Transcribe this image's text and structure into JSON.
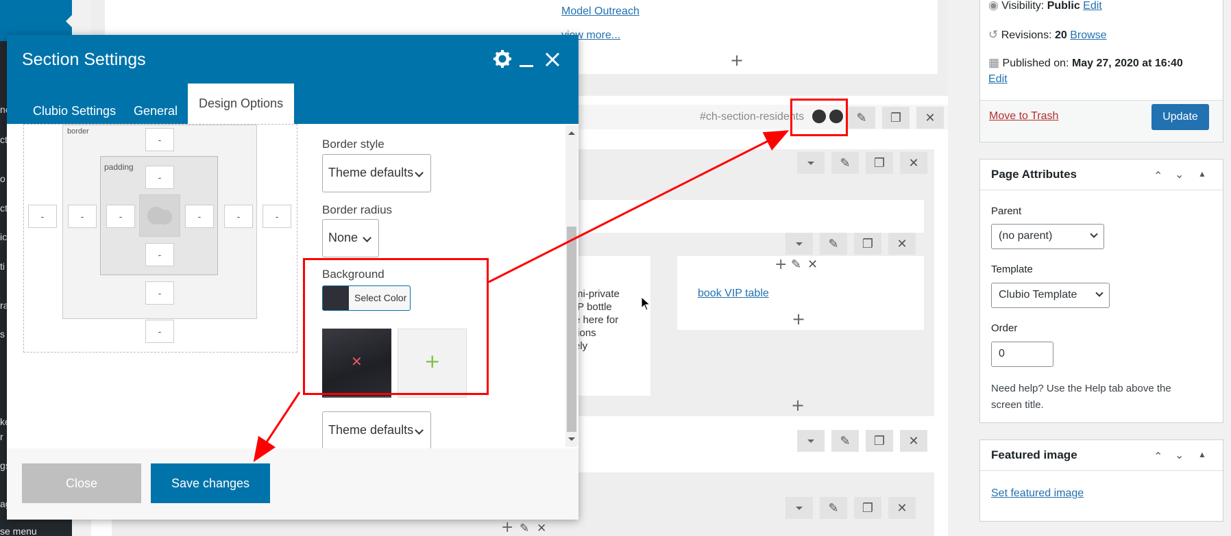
{
  "admin_menu": {
    "fragments": [
      "ne",
      "ct",
      "o",
      "ct",
      "ic",
      "ti",
      "ra",
      "s",
      "ke",
      "r",
      "gs",
      "ag"
    ],
    "collapse_label": "se menu"
  },
  "canvas": {
    "link_model_outreach": "Model Outreach",
    "link_view_more": "view more...",
    "section_id": "#ch-section-residents",
    "text_snippet": [
      "mi-private",
      "IP bottle",
      "e here for",
      "tions",
      "ely"
    ],
    "link_book_vip": "book VIP table"
  },
  "publish": {
    "visibility_label": "Visibility:",
    "visibility_value": "Public",
    "visibility_edit": "Edit",
    "revisions_label": "Revisions:",
    "revisions_value": "20",
    "revisions_browse": "Browse",
    "published_label": "Published on:",
    "published_value": "May 27, 2020 at 16:40",
    "published_edit": "Edit",
    "trash_label": "Move to Trash",
    "update_label": "Update"
  },
  "page_attributes": {
    "title": "Page Attributes",
    "parent_label": "Parent",
    "parent_value": "(no parent)",
    "template_label": "Template",
    "template_value": "Clubio Template",
    "order_label": "Order",
    "order_value": "0",
    "help_text": "Need help? Use the Help tab above the screen title."
  },
  "featured_image": {
    "title": "Featured image",
    "set_link": "Set featured image"
  },
  "modal": {
    "title": "Section Settings",
    "tabs": [
      "Clubio Settings",
      "General",
      "Design Options"
    ],
    "box_labels": {
      "border": "border",
      "padding": "padding"
    },
    "box_placeholder": "-",
    "border_style_label": "Border style",
    "border_style_value": "Theme defaults",
    "border_radius_label": "Border radius",
    "border_radius_value": "None",
    "background_label": "Background",
    "select_color_label": "Select Color",
    "background_style_value": "Theme defaults",
    "close_label": "Close",
    "save_label": "Save changes"
  },
  "colors": {
    "accent": "#0073aa",
    "annotation": "#ff0000",
    "admin_bg": "#23282d"
  }
}
